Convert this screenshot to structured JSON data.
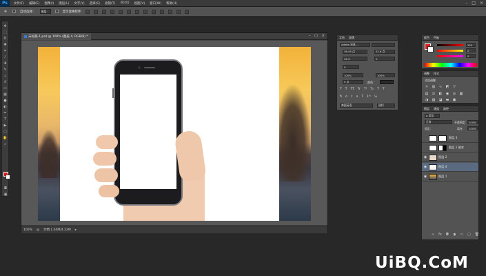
{
  "app": {
    "logo": "Ps"
  },
  "menu": [
    "文件(F)",
    "编辑(E)",
    "图像(I)",
    "图层(L)",
    "文字(Y)",
    "选择(S)",
    "滤镜(T)",
    "3D(D)",
    "视图(V)",
    "窗口(W)",
    "帮助(H)"
  ],
  "window_controls": [
    "–",
    "□",
    "×"
  ],
  "options": {
    "auto_select": "自动选择：",
    "auto_select_value": "图层",
    "transform": "显示变换控件"
  },
  "document": {
    "tab_title": "未标题-1.psd @ 100% (图层 4, RGB/8) *",
    "zoom": "100%",
    "doc_info": "文档:1.04M/4.22M"
  },
  "character_panel": {
    "tabs": [
      "字符",
      "段落"
    ],
    "font_family": "Adobe 宋体 ...",
    "font_style": "-",
    "size": "36.45 点",
    "leading": "52.8 点",
    "tracking": "0",
    "kerning": "VA 0",
    "scale_v": "100%",
    "scale_h": "100%",
    "baseline": "0 点",
    "color_label": "颜色：",
    "language": "美国英语",
    "antialias": "锐利",
    "style_buttons": [
      "T",
      "T",
      "TT",
      "Tr",
      "T¹",
      "T₁",
      "T",
      "T"
    ]
  },
  "color_panel": {
    "tabs": [
      "颜色",
      "色板"
    ],
    "values": [
      "255",
      "0",
      "0"
    ],
    "colors": {
      "fg": "#e21b1b",
      "bg": "#ffffff"
    }
  },
  "adjustments_panel": {
    "tabs": [
      "调整",
      "样式"
    ],
    "add_label": "添加调整"
  },
  "layers_panel": {
    "tabs": [
      "图层",
      "通道",
      "路径"
    ],
    "filter": "ρ 类型",
    "blend_mode": "正常",
    "opacity_label": "不透明度：",
    "opacity": "100%",
    "lock_label": "锁定：",
    "fill_label": "填充：",
    "fill": "100%",
    "layers": [
      {
        "name": "图层 3",
        "visible": false
      },
      {
        "name": "图层 1 副本",
        "visible": false
      },
      {
        "name": "图层 2",
        "visible": true
      },
      {
        "name": "图层 4",
        "visible": true,
        "selected": true
      },
      {
        "name": "图层 1",
        "visible": true
      }
    ]
  },
  "watermark": "UiBQ.CoM"
}
